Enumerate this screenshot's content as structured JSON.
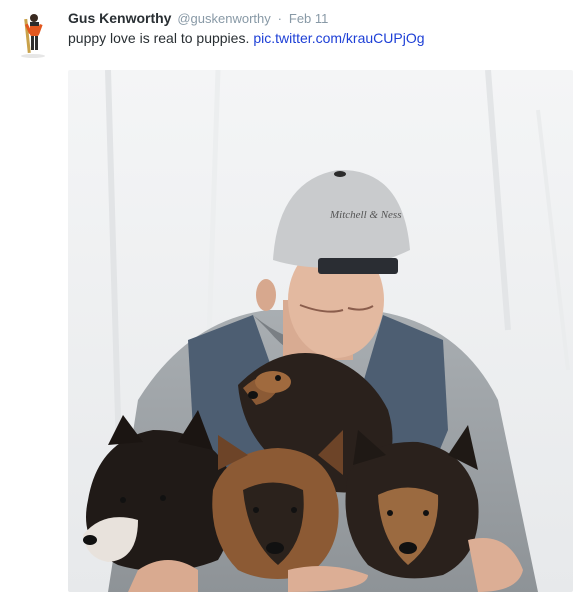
{
  "tweet": {
    "fullname": "Gus Kenworthy",
    "username": "@guskenworthy",
    "separator": "·",
    "date": "Feb 11",
    "text": "puppy love is real to puppies.",
    "link": "pic.twitter.com/krauCUPjOg"
  },
  "icons": {
    "avatar": "user-avatar-icon",
    "photo": "tweet-photo"
  },
  "colors": {
    "name": "#292f33",
    "meta": "#8899a6",
    "link": "#1d3fd6"
  }
}
